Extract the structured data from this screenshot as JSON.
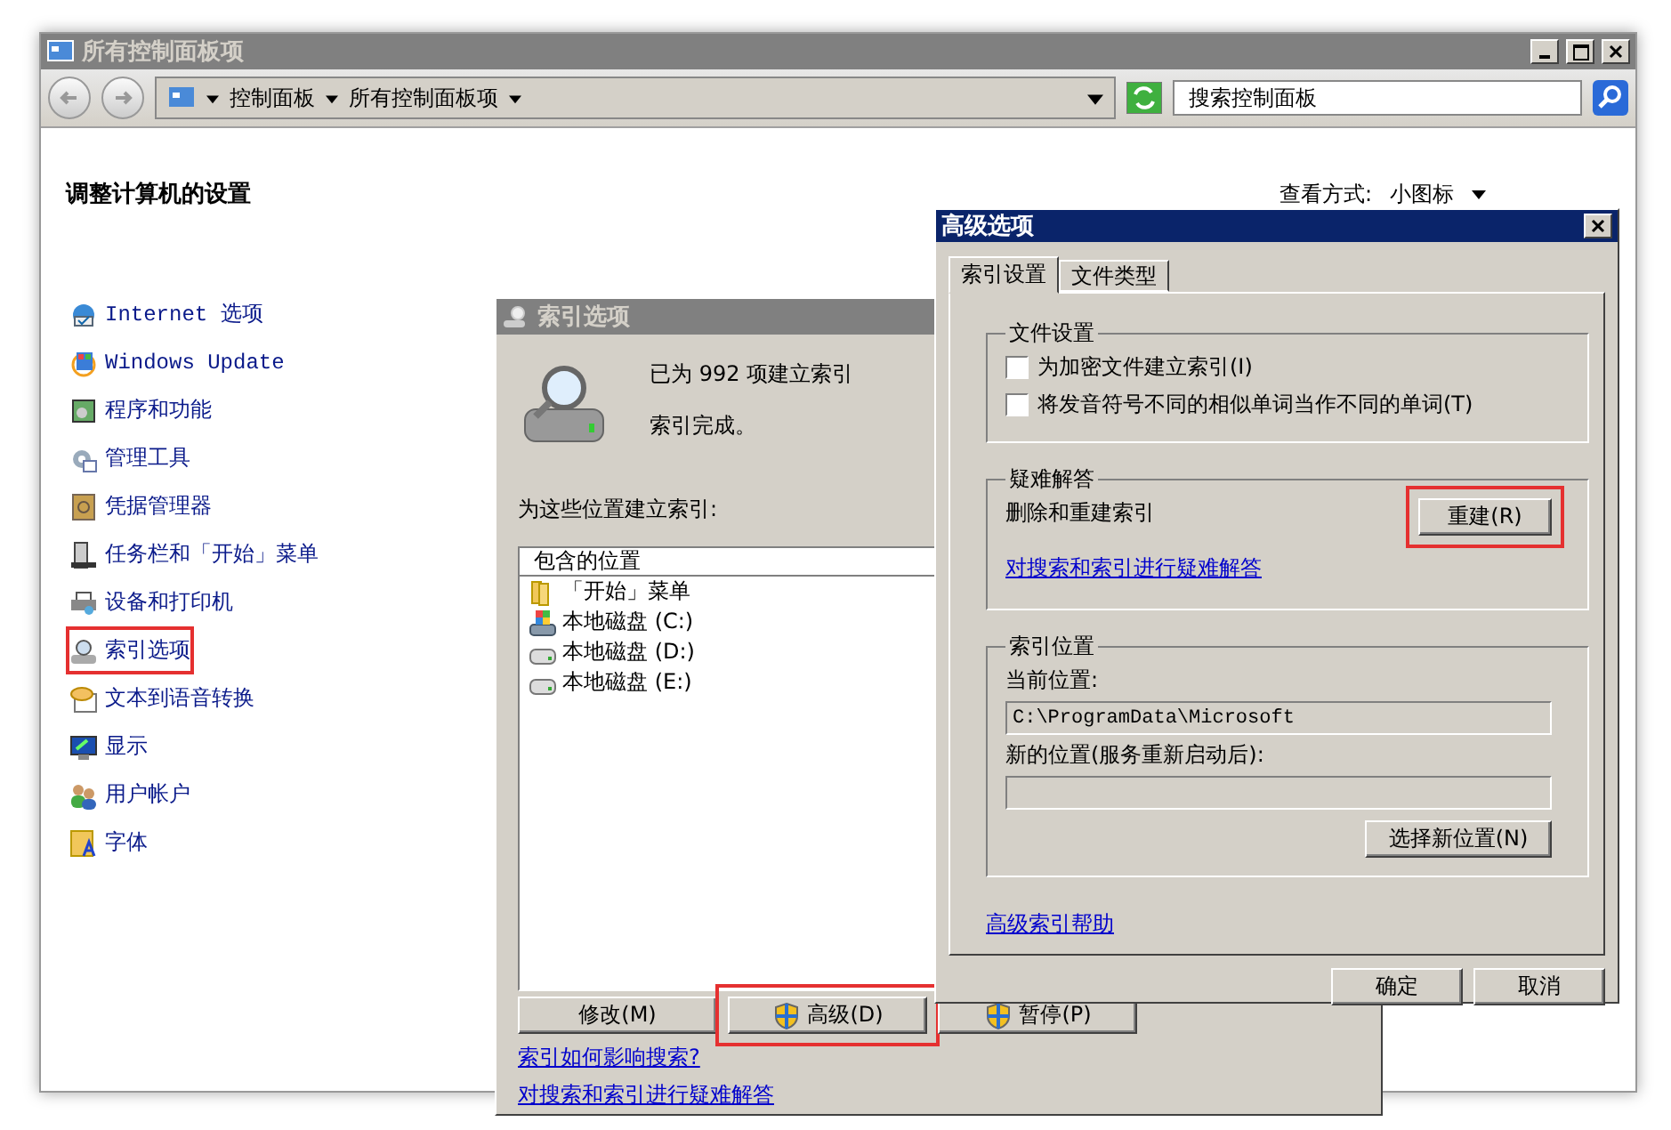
{
  "window": {
    "title": "所有控制面板项"
  },
  "address_bar": {
    "crumbs": [
      "控制面板",
      "所有控制面板项"
    ]
  },
  "search": {
    "placeholder": "搜索控制面板"
  },
  "heading": "调整计算机的设置",
  "view_by": {
    "label": "查看方式:",
    "value": "小图标"
  },
  "sidebar": {
    "items": [
      {
        "label": "Internet 选项",
        "highlighted": false
      },
      {
        "label": "Windows Update",
        "highlighted": false
      },
      {
        "label": "程序和功能",
        "highlighted": false
      },
      {
        "label": "管理工具",
        "highlighted": false
      },
      {
        "label": "凭据管理器",
        "highlighted": false
      },
      {
        "label": "任务栏和「开始」菜单",
        "highlighted": false
      },
      {
        "label": "设备和打印机",
        "highlighted": false
      },
      {
        "label": "索引选项",
        "highlighted": true
      },
      {
        "label": "文本到语音转换",
        "highlighted": false
      },
      {
        "label": "显示",
        "highlighted": false
      },
      {
        "label": "用户帐户",
        "highlighted": false
      },
      {
        "label": "字体",
        "highlighted": false
      }
    ]
  },
  "index_dialog": {
    "title": "索引选项",
    "status": [
      "已为 992 项建立索引",
      "索引完成。"
    ],
    "locations_label": "为这些位置建立索引:",
    "list_header": "包含的位置",
    "locations": [
      {
        "label": "「开始」菜单",
        "kind": "folder"
      },
      {
        "label": "本地磁盘 (C:)",
        "kind": "system"
      },
      {
        "label": "本地磁盘 (D:)",
        "kind": "drive"
      },
      {
        "label": "本地磁盘 (E:)",
        "kind": "drive"
      }
    ],
    "buttons": [
      {
        "label": "修改(M)",
        "kind": "plain",
        "highlighted": false
      },
      {
        "label": "高级(D)",
        "kind": "shield",
        "highlighted": true
      },
      {
        "label": "暂停(P)",
        "kind": "shield",
        "highlighted": false
      }
    ],
    "links": [
      "索引如何影响搜索?",
      "对搜索和索引进行疑难解答"
    ]
  },
  "advanced_dialog": {
    "title": "高级选项",
    "tabs": [
      {
        "label": "索引设置",
        "selected": true
      },
      {
        "label": "文件类型",
        "selected": false
      }
    ],
    "file_settings": {
      "title": "文件设置",
      "options": [
        {
          "label": "为加密文件建立索引(I)",
          "checked": false
        },
        {
          "label": "将发音符号不同的相似单词当作不同的单词(T)",
          "checked": false
        }
      ]
    },
    "troubleshooting": {
      "title": "疑难解答",
      "text": "删除和重建索引",
      "button": {
        "label": "重建(R)",
        "highlighted": true
      },
      "link": "对搜索和索引进行疑难解答"
    },
    "location": {
      "title": "索引位置",
      "current_label": "当前位置:",
      "current_value": "C:\\ProgramData\\Microsoft",
      "new_label": "新的位置(服务重新启动后):",
      "button": "选择新位置(N)"
    },
    "help_link": "高级索引帮助",
    "buttons": [
      "确定",
      "取消"
    ]
  }
}
